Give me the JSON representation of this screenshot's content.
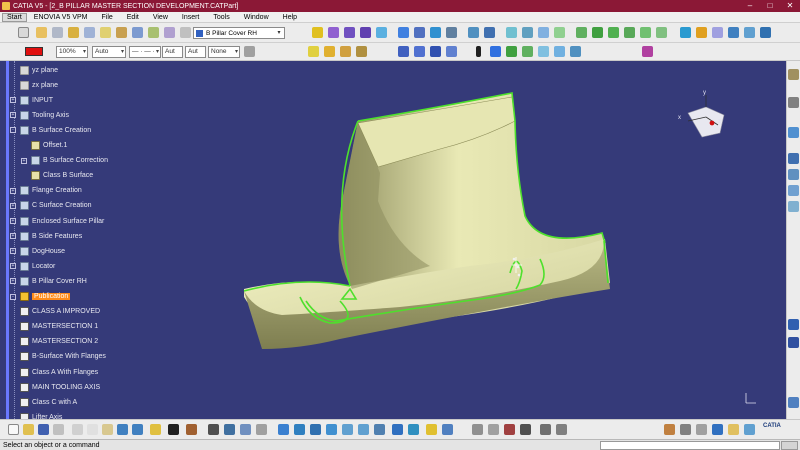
{
  "window": {
    "title": "CATIA V5 - [2_B PILLAR MASTER SECTION DEVELOPMENT.CATPart]",
    "controls": [
      "–",
      "□",
      "✕"
    ]
  },
  "menubar": {
    "items": [
      "Start",
      "ENOVIA V5 VPM",
      "File",
      "Edit",
      "View",
      "Insert",
      "Tools",
      "Window",
      "Help"
    ]
  },
  "toolbar": {
    "current_body": "B Pillar Cover RH"
  },
  "properties": {
    "color": "#e01010",
    "transparency": "100%",
    "line_weight": "Auto",
    "line_type": "— · — ·",
    "layer_a": "Aut",
    "layer_b": "Aut",
    "rendering": "None"
  },
  "tree": {
    "items": [
      {
        "label": "yz plane",
        "icon": "plane-icon",
        "expander": ""
      },
      {
        "label": "zx plane",
        "icon": "plane-icon",
        "expander": ""
      },
      {
        "label": "INPUT",
        "icon": "geometrical-set-icon",
        "expander": "+"
      },
      {
        "label": "Tooling Axis",
        "icon": "geometrical-set-icon",
        "expander": "+"
      },
      {
        "label": "B Surface Creation",
        "icon": "geometrical-set-icon",
        "expander": "-"
      },
      {
        "label": "Offset.1",
        "icon": "surface-icon",
        "expander": ""
      },
      {
        "label": "B Surface Correction",
        "icon": "geometrical-set-icon",
        "expander": "+"
      },
      {
        "label": "Class B Surface",
        "icon": "surface-icon",
        "expander": ""
      },
      {
        "label": "Flange Creation",
        "icon": "geometrical-set-icon",
        "expander": "+"
      },
      {
        "label": "C Surface Creation",
        "icon": "geometrical-set-icon",
        "expander": "+"
      },
      {
        "label": "Enclosed Surface Pillar",
        "icon": "geometrical-set-icon",
        "expander": "+"
      },
      {
        "label": "B Side Features",
        "icon": "geometrical-set-icon",
        "expander": "+"
      },
      {
        "label": "DogHouse",
        "icon": "geometrical-set-icon",
        "expander": "+"
      },
      {
        "label": "Locator",
        "icon": "geometrical-set-icon",
        "expander": "+"
      },
      {
        "label": "B Pillar Cover RH",
        "icon": "geometrical-set-icon",
        "expander": "+"
      },
      {
        "label": "Publication",
        "icon": "publication-icon",
        "expander": "-",
        "selected": true
      },
      {
        "label": "CLASS A IMPROVED",
        "icon": "reference-icon",
        "expander": ""
      },
      {
        "label": "MASTERSECTION 1",
        "icon": "reference-icon",
        "expander": ""
      },
      {
        "label": "MASTERSECTION 2",
        "icon": "reference-icon",
        "expander": ""
      },
      {
        "label": "B-Surface With Flanges",
        "icon": "reference-icon",
        "expander": ""
      },
      {
        "label": "Class A With Flanges",
        "icon": "reference-icon",
        "expander": ""
      },
      {
        "label": "MAIN TOOLING AXIS",
        "icon": "reference-icon",
        "expander": ""
      },
      {
        "label": "Class C with A",
        "icon": "reference-icon",
        "expander": ""
      },
      {
        "label": "Lifter Axis",
        "icon": "reference-icon",
        "expander": ""
      }
    ]
  },
  "compass": {
    "x_label": "x",
    "y_label": "y",
    "z_label": "z"
  },
  "model": {
    "surface_color": "#e6e6b2",
    "edge_color": "#4ee02c",
    "background_color": "#353a79"
  },
  "bottom": {
    "logo": "CATIA"
  },
  "status": {
    "message": "Select an object or a command"
  }
}
